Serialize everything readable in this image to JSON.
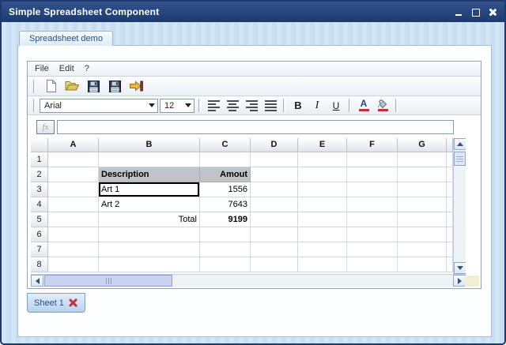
{
  "window": {
    "title": "Simple Spreadsheet Component",
    "controls": [
      "minimize",
      "maximize",
      "close"
    ]
  },
  "doc_tab": {
    "label": "Spreadsheet demo"
  },
  "menu": {
    "items": [
      "File",
      "Edit",
      "?"
    ]
  },
  "toolbar": {
    "icons": [
      "new-document-icon",
      "open-folder-icon",
      "save-icon",
      "save-as-icon",
      "exit-icon"
    ]
  },
  "format_toolbar": {
    "font_family": "Arial",
    "font_size": "12",
    "bold_label": "B",
    "italic_label": "I",
    "underline_label": "U",
    "font_color_label": "A",
    "icons": [
      "align-left-icon",
      "align-center-icon",
      "align-right-icon",
      "align-justify-icon",
      "font-color-icon",
      "fill-color-icon"
    ]
  },
  "formula_bar": {
    "button_label": "fx",
    "input_value": ""
  },
  "spreadsheet": {
    "column_headers": [
      "A",
      "B",
      "C",
      "D",
      "E",
      "F",
      "G"
    ],
    "row_headers": [
      "1",
      "2",
      "3",
      "4",
      "5",
      "6",
      "7",
      "8"
    ],
    "cells": {
      "B2": {
        "v": "Description",
        "bold": true,
        "gray": true
      },
      "C2": {
        "v": "Amout",
        "bold": true,
        "gray": true,
        "right": true
      },
      "B3": {
        "v": "Art 1",
        "selected": true
      },
      "C3": {
        "v": "1556",
        "right": true
      },
      "B4": {
        "v": "Art 2"
      },
      "C4": {
        "v": "7643",
        "right": true
      },
      "B5": {
        "v": "Total",
        "right": true
      },
      "C5": {
        "v": "9199",
        "right": true,
        "bold": true
      }
    },
    "selected_cell": "B3"
  },
  "sheet_tabs": {
    "sheet1_label": "Sheet 1",
    "delete_icon": "delete-sheet-x-icon"
  },
  "colors": {
    "titlebar": "#1b3a6e",
    "window_body": "#cfe2f3",
    "tab_text": "#1e4d86",
    "header_cell_bg": "#c0c3c7",
    "selection_border": "#000000",
    "delete_x": "#c4333c",
    "scroll_thumb": "#c9d3f0"
  }
}
